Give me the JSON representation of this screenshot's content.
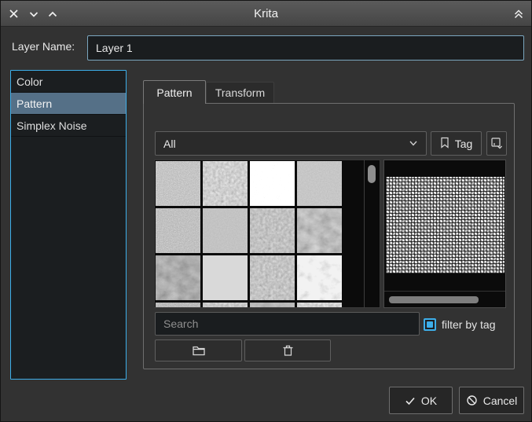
{
  "titlebar": {
    "title": "Krita",
    "window_controls": [
      "close",
      "shade-down",
      "shade-up"
    ],
    "right_control": "collapse"
  },
  "form": {
    "layer_name_label": "Layer Name:",
    "layer_name_value": "Layer 1"
  },
  "generator_list": {
    "items": [
      "Color",
      "Pattern",
      "Simplex Noise"
    ],
    "selected_index": 1
  },
  "tabs": {
    "selected": "Pattern",
    "items": [
      "Pattern",
      "Transform"
    ]
  },
  "pattern_panel": {
    "tag_dropdown_value": "All",
    "tag_button_label": "Tag",
    "search_placeholder": "Search",
    "filter_by_tag": {
      "label": "filter by tag",
      "checked": true
    },
    "grid": {
      "columns": 4,
      "visible_rows": 3,
      "tiles": [
        {
          "f": "f-fine",
          "b": 1.0,
          "c": 1.0
        },
        {
          "f": "f-coarse",
          "b": 1.02,
          "c": 1.05
        },
        {
          "f": "f-canvas",
          "b": 1.5,
          "c": 1.1
        },
        {
          "f": "f-smooth",
          "b": 1.0,
          "c": 1.0
        },
        {
          "f": "f-fine",
          "b": 0.98,
          "c": 1.0
        },
        {
          "f": "f-smooth",
          "b": 1.02,
          "c": 0.9
        },
        {
          "f": "f-coarse",
          "b": 0.97,
          "c": 1.0
        },
        {
          "f": "f-blotch",
          "b": 0.9,
          "c": 1.15
        },
        {
          "f": "f-blotch",
          "b": 0.84,
          "c": 1.1
        },
        {
          "f": "f-fine",
          "b": 1.55,
          "c": 0.7
        },
        {
          "f": "f-coarse",
          "b": 0.95,
          "c": 1.1
        },
        {
          "f": "f-blotch",
          "b": 1.28,
          "c": 0.9
        },
        {
          "f": "f-fine",
          "b": 0.95,
          "c": 1.0
        },
        {
          "f": "f-coarse",
          "b": 1.0,
          "c": 1.0
        },
        {
          "f": "f-blotch",
          "b": 0.9,
          "c": 1.0
        },
        {
          "f": "f-coarse",
          "b": 1.05,
          "c": 1.0
        }
      ]
    }
  },
  "resource_buttons": {
    "import_icon": "folder-icon",
    "delete_icon": "trash-icon"
  },
  "dialog_buttons": {
    "ok": "OK",
    "cancel": "Cancel"
  },
  "colors": {
    "focus_blue": "#3daee9",
    "selection_blue": "#557087",
    "window_bg": "#323232",
    "field_bg": "#1a1d1f",
    "list_bg": "#0b0b0b"
  }
}
